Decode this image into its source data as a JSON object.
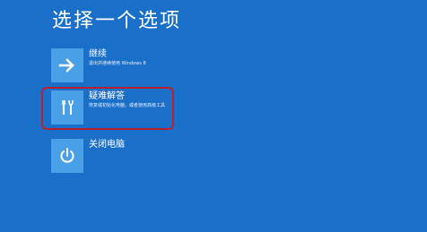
{
  "page_title": "选择一个选项",
  "options": [
    {
      "id": "continue",
      "label": "继续",
      "desc": "退出并继续使用 Windows 8",
      "icon": "arrow-right-icon"
    },
    {
      "id": "troubleshoot",
      "label": "疑难解答",
      "desc": "恢复或初始化电脑，或者使用高级工具",
      "icon": "tools-icon"
    },
    {
      "id": "shutdown",
      "label": "关闭电脑",
      "desc": "",
      "icon": "power-icon"
    }
  ],
  "colors": {
    "background": "#1a6fc8",
    "tile": "#4aa0e6",
    "highlight": "#b8202e"
  }
}
